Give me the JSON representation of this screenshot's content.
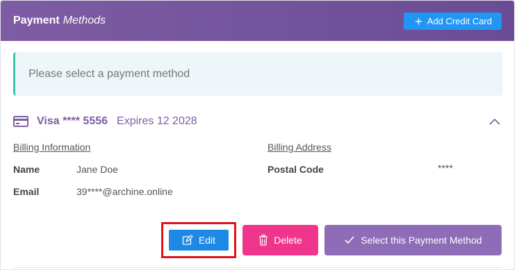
{
  "header": {
    "title_bold": "Payment",
    "title_italic": "Methods",
    "add_button_label": "Add Credit Card"
  },
  "notice": {
    "text": "Please select a payment method"
  },
  "method": {
    "label": "Visa **** 5556",
    "expires": "Expires 12 2028"
  },
  "billing_information": {
    "heading": "Billing Information",
    "name_label": "Name",
    "name_value": "Jane Doe",
    "email_label": "Email",
    "email_value": "39****@archine.online"
  },
  "billing_address": {
    "heading": "Billing Address",
    "postal_label": "Postal Code",
    "postal_value": "****"
  },
  "actions": {
    "edit_label": "Edit",
    "delete_label": "Delete",
    "select_label": "Select this Payment Method"
  },
  "colors": {
    "header_purple": "#7e5ca4",
    "accent_blue": "#2196f3",
    "delete_pink": "#f0368c",
    "select_purple": "#8e6cb7",
    "highlight_red": "#e0101c",
    "notice_teal": "#3cc4a9"
  },
  "icons": {
    "add": "plus-icon",
    "card": "credit-card-icon",
    "collapse": "chevron-up-icon",
    "edit": "edit-icon",
    "delete": "trash-icon",
    "select": "check-icon"
  }
}
